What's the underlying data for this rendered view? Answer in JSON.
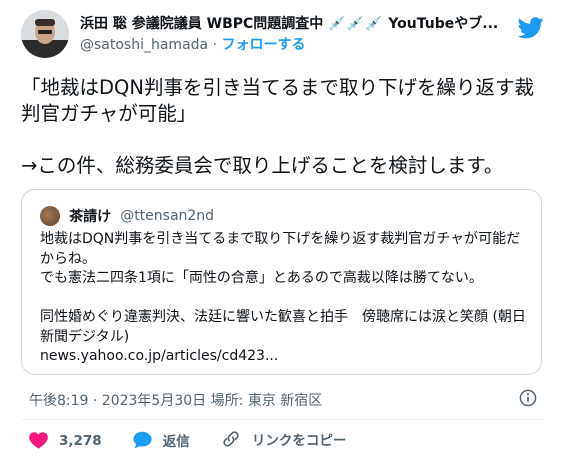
{
  "author": {
    "display_name": "浜田 聡 参議院議員 WBPC問題調査中",
    "name_emoji": "💉💉💉",
    "name_suffix": "YouTubeやブ...",
    "handle": "@satoshi_hamada",
    "separator": "·",
    "follow_label": "フォローする"
  },
  "tweet": {
    "line1": "「地裁はDQN判事を引き当てるまで取り下げを繰り返す裁判官ガチャが可能」",
    "line2": "→この件、総務委員会で取り上げることを検討します。"
  },
  "quote": {
    "name": "茶請け",
    "handle": "@ttensan2nd",
    "line1": "地裁はDQN判事を引き当てるまで取り下げを繰り返す裁判官ガチャが可能だからね。",
    "line2": "でも憲法二四条1項に「両性の合意」とあるので高裁以降は勝てない。",
    "line3": "同性婚めぐり違憲判決、法廷に響いた歓喜と拍手　傍聴席には涙と笑顔 (朝日新聞デジタル)",
    "link": "news.yahoo.co.jp/articles/cd423..."
  },
  "meta": {
    "timestamp": "午後8:19 · 2023年5月30日",
    "location": "場所: 東京 新宿区"
  },
  "actions": {
    "like_count": "3,278",
    "reply_label": "返信",
    "copy_link_label": "リンクをコピー"
  },
  "colors": {
    "brand_blue": "#1d9bf0",
    "like_pink": "#f91880",
    "text_secondary": "#536471"
  }
}
